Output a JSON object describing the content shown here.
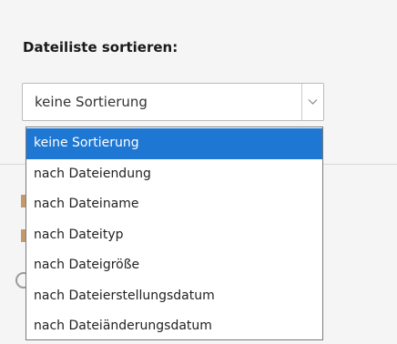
{
  "form": {
    "sort_label": "Dateiliste sortieren:",
    "sort_select": {
      "selected_value": "keine Sortierung",
      "options": [
        "keine Sortierung",
        "nach Dateiendung",
        "nach Dateiname",
        "nach Dateityp",
        "nach Dateigröße",
        "nach Dateierstellungsdatum",
        "nach Dateiänderungsdatum"
      ],
      "highlighted_index": 0
    }
  },
  "colors": {
    "highlight": "#1e77d3",
    "background": "#f5f5f5"
  },
  "icons": {
    "select_arrow": "chevron-down-icon"
  }
}
